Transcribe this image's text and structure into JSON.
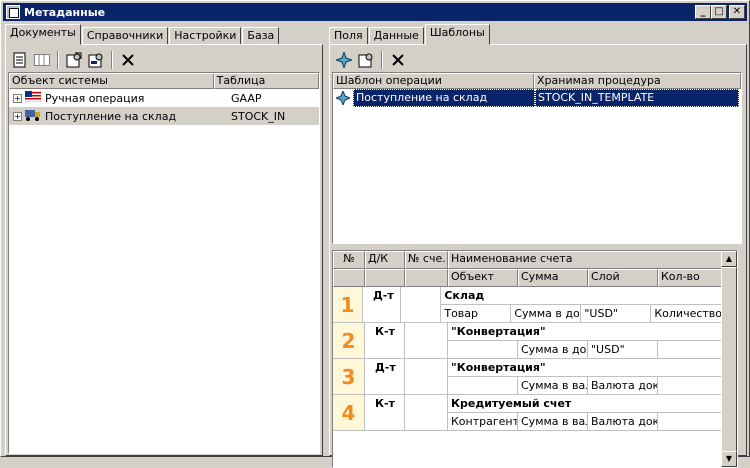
{
  "window": {
    "title": "Метаданные"
  },
  "left": {
    "tabs": [
      "Документы",
      "Справочники",
      "Настройки",
      "База"
    ],
    "columns": [
      "Объект системы",
      "Таблица"
    ],
    "rows": [
      {
        "name": "Ручная операция",
        "table": "GAAP",
        "icon": "flag-icon"
      },
      {
        "name": "Поступление на склад",
        "table": "STOCK_IN",
        "icon": "truck-icon"
      }
    ]
  },
  "right": {
    "tabs": [
      "Поля",
      "Данные",
      "Шаблоны"
    ],
    "top_columns": [
      "Шаблон операции",
      "Хранимая процедура"
    ],
    "top_rows": [
      {
        "template": "Поступление на склад",
        "procedure": "STOCK_IN_TEMPLATE"
      }
    ],
    "bottom_columns": [
      "№",
      "Д/К",
      "№ сче...",
      "Наименование счета"
    ],
    "bottom_subcolumns": [
      "Объект",
      "Сумма",
      "Слой",
      "Кол-во"
    ],
    "entries": [
      {
        "num": "1",
        "dk": "Д-т",
        "account": "Склад",
        "obj": "Товар",
        "sum": "Сумма в дол",
        "layer": "\"USD\"",
        "qty": "Количество"
      },
      {
        "num": "2",
        "dk": "К-т",
        "account": "\"Конвертация\"",
        "obj": "",
        "sum": "Сумма в дол",
        "layer": "\"USD\"",
        "qty": ""
      },
      {
        "num": "3",
        "dk": "Д-т",
        "account": "\"Конвертация\"",
        "obj": "",
        "sum": "Сумма в вал",
        "layer": "Валюта доку",
        "qty": ""
      },
      {
        "num": "4",
        "dk": "К-т",
        "account": "Кредитуемый счет",
        "obj": "Контрагент",
        "sum": "Сумма в вал",
        "layer": "Валюта доку",
        "qty": ""
      }
    ]
  }
}
